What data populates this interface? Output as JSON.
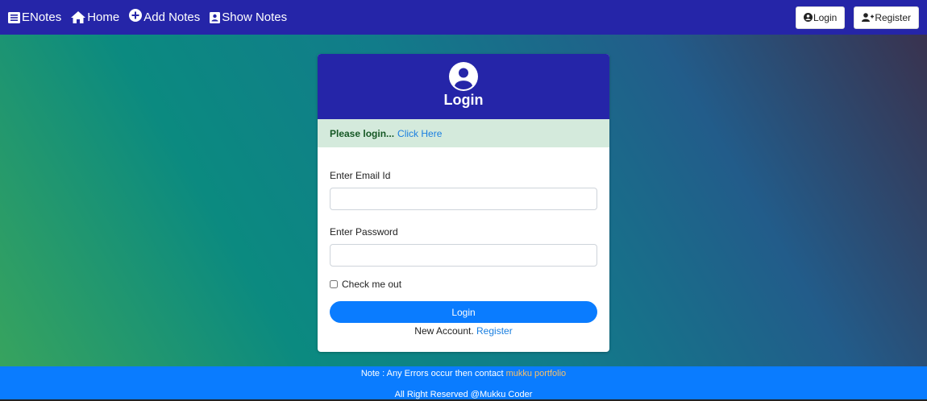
{
  "navbar": {
    "brand": "ENotes",
    "home": "Home",
    "add_notes": "Add Notes",
    "show_notes": "Show Notes",
    "login_button": "Login",
    "register_button": "Register"
  },
  "card": {
    "title": "Login",
    "alert_text": "Please login...",
    "alert_link": "Click Here",
    "email_label": "Enter Email Id",
    "email_value": "",
    "password_label": "Enter Password",
    "password_value": "",
    "checkbox_label": "Check me out",
    "submit_label": "Login",
    "new_account_text": "New Account.",
    "register_link": "Register"
  },
  "footer": {
    "note_text": "Note : Any Errors occur then contact",
    "note_link": "mukku portfolio",
    "copyright": "All Right Reserved @Mukku Coder"
  },
  "colors": {
    "navbar_bg": "#2525a8",
    "primary_button": "#0a7cff",
    "alert_bg": "#d4eadc",
    "link": "#1a7fe0",
    "footer_link": "#f5c06a"
  }
}
